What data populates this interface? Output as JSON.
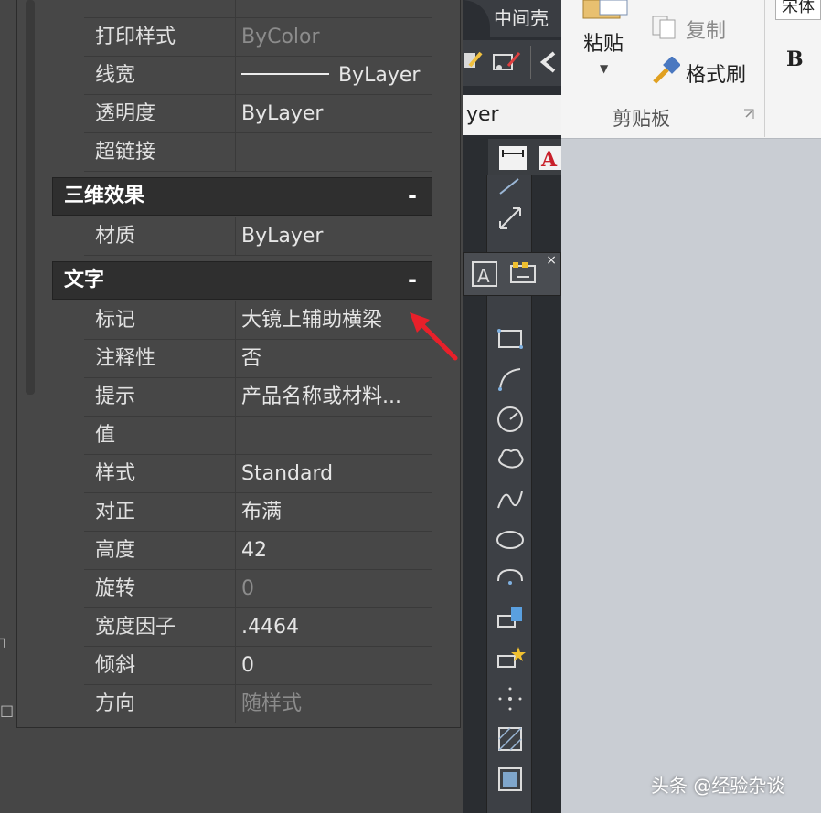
{
  "properties_palette": {
    "top_rows": [
      {
        "name": "打印样式",
        "value": "ByColor",
        "dim": true
      },
      {
        "name": "线宽",
        "value": "ByLayer",
        "line_sample": true
      },
      {
        "name": "透明度",
        "value": "ByLayer"
      },
      {
        "name": "超链接",
        "value": ""
      }
    ],
    "section_3d": {
      "title": "三维效果",
      "collapse": "-",
      "rows": [
        {
          "name": "材质",
          "value": "ByLayer"
        }
      ]
    },
    "section_text": {
      "title": "文字",
      "collapse": "-",
      "rows": [
        {
          "name": "标记",
          "value": "大镜上辅助横梁"
        },
        {
          "name": "注释性",
          "value": "否"
        },
        {
          "name": "提示",
          "value": "产品名称或材料..."
        },
        {
          "name": "值",
          "value": ""
        },
        {
          "name": "样式",
          "value": "Standard"
        },
        {
          "name": "对正",
          "value": "布满"
        },
        {
          "name": "高度",
          "value": "42"
        },
        {
          "name": "旋转",
          "value": "0",
          "dim": true
        },
        {
          "name": "宽度因子",
          "value": ".4464"
        },
        {
          "name": "倾斜",
          "value": "0"
        },
        {
          "name": "方向",
          "value": "随样式",
          "dim": true
        }
      ]
    }
  },
  "toolbar": {
    "tab_label": "中间壳",
    "layer_value": "yer"
  },
  "ribbon": {
    "paste_label": "粘贴",
    "copy_label": "复制",
    "format_painter_label": "格式刷",
    "clipboard_group": "剪贴板",
    "bold_label": "B",
    "font_box": "宋体"
  },
  "watermark": "头条 @经验杂谈",
  "colors": {
    "accent_arrow": "#e8202a",
    "panel_bg": "#474747",
    "ribbon_bg": "#f4f4f4"
  }
}
